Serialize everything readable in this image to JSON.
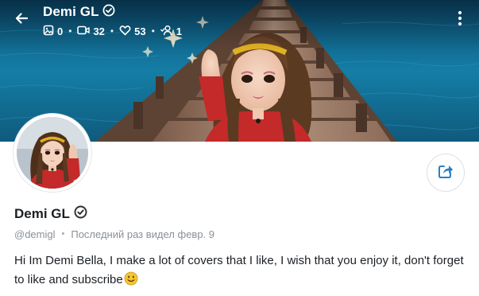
{
  "header": {
    "title": "Demi GL",
    "verified": true,
    "stats": {
      "photos": "0",
      "videos": "32",
      "likes": "53",
      "followers": "1"
    }
  },
  "profile": {
    "name": "Demi GL",
    "handle": "@demigl",
    "last_seen": "Последний раз видел февр. 9",
    "bio": "Hi Im Demi Bella, I make a lot of covers that I like, I wish that you enjoy it, don't forget to like and subscribe"
  },
  "icons": {
    "back": "arrow-left-icon",
    "verified": "verified-badge-icon",
    "photos": "image-icon",
    "videos": "video-icon",
    "likes": "heart-icon",
    "followers": "user-check-icon",
    "menu": "more-vertical-icon",
    "share": "share-icon",
    "emoji": "smiling-face-emoji"
  },
  "colors": {
    "accent": "#2d7fc1",
    "text": "#1b1f24",
    "muted": "#8a9097",
    "water": "#137aa3",
    "card_bg": "#ffffff"
  }
}
